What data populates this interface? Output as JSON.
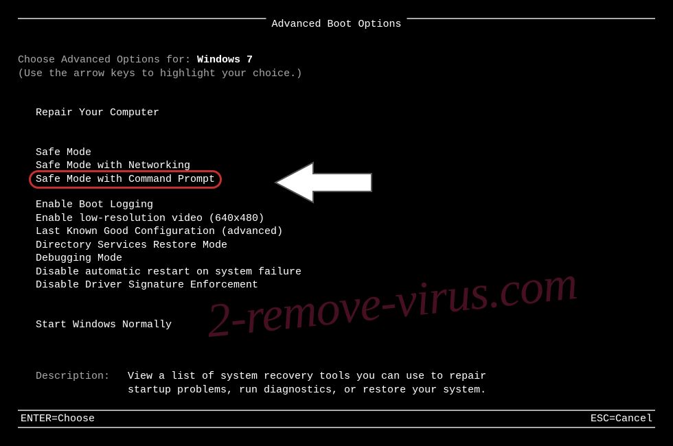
{
  "title": "Advanced Boot Options",
  "prompt_prefix": "Choose Advanced Options for: ",
  "os_name": "Windows 7",
  "hint": "(Use the arrow keys to highlight your choice.)",
  "options": {
    "repair": "Repair Your Computer",
    "safe": "Safe Mode",
    "safe_net": "Safe Mode with Networking",
    "safe_cmd": "Safe Mode with Command Prompt",
    "bootlog": "Enable Boot Logging",
    "lowres": "Enable low-resolution video (640x480)",
    "lkgc": "Last Known Good Configuration (advanced)",
    "dsrm": "Directory Services Restore Mode",
    "debug": "Debugging Mode",
    "noauto": "Disable automatic restart on system failure",
    "nosig": "Disable Driver Signature Enforcement",
    "normal": "Start Windows Normally"
  },
  "description_label": "Description:",
  "description_text": "View a list of system recovery tools you can use to repair startup problems, run diagnostics, or restore your system.",
  "footer": {
    "enter": "ENTER=Choose",
    "esc": "ESC=Cancel"
  },
  "watermark": "2-remove-virus.com"
}
